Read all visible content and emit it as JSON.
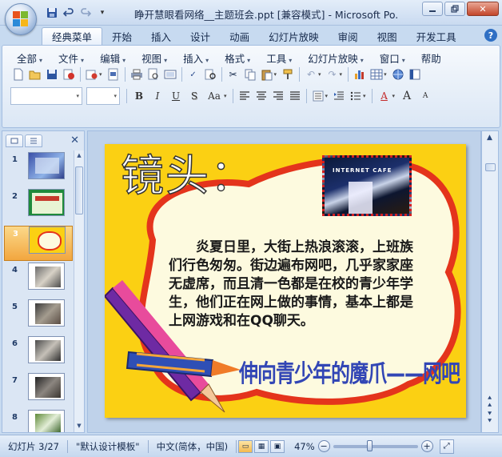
{
  "window": {
    "title": "睁开慧眼看网络__主题班会.ppt [兼容模式] - Microsoft Po...",
    "minimize_icon": "minimize-icon",
    "maximize_icon": "restore-icon",
    "close_icon": "close-icon"
  },
  "quick_access": [
    "save-icon",
    "undo-icon",
    "redo-icon",
    "customize-icon"
  ],
  "tabs": [
    "经典菜单",
    "开始",
    "插入",
    "设计",
    "动画",
    "幻灯片放映",
    "审阅",
    "视图",
    "开发工具"
  ],
  "active_tab": "经典菜单",
  "help_label": "?",
  "menus": [
    "全部",
    "文件",
    "编辑",
    "视图",
    "插入",
    "格式",
    "工具",
    "幻灯片放映",
    "窗口",
    "帮助"
  ],
  "toolbar_icons_row1": [
    "new-icon",
    "open-icon",
    "save-icon",
    "permission-icon",
    "email-icon",
    "pdf-icon",
    "print-icon",
    "print-preview-icon",
    "spelling-icon",
    "research-icon",
    "cut-icon",
    "copy-icon",
    "paste-icon",
    "format-painter-icon",
    "undo-icon",
    "redo-icon",
    "chart-icon",
    "table-icon",
    "hyperlink-icon",
    "slide-icon"
  ],
  "toolbar_icons_row2": [
    "bold-icon",
    "italic-icon",
    "underline-icon",
    "shadow-icon",
    "change-case-icon",
    "align-left-icon",
    "align-center-icon",
    "align-right-icon",
    "justify-icon",
    "numbering-icon",
    "decrease-indent-icon",
    "bullets-icon",
    "font-color-icon",
    "grow-font-icon",
    "shrink-font-icon"
  ],
  "font_format": {
    "bold": "B",
    "italic": "I",
    "underline": "U",
    "shadow": "S",
    "case": "Aa",
    "grow": "A",
    "shrink": "A"
  },
  "slides": [
    {
      "number": "1",
      "style": "blue"
    },
    {
      "number": "2",
      "style": "green"
    },
    {
      "number": "3",
      "style": "yellow"
    },
    {
      "number": "4",
      "style": "photo"
    },
    {
      "number": "5",
      "style": "photo"
    },
    {
      "number": "6",
      "style": "photo"
    },
    {
      "number": "7",
      "style": "photo"
    },
    {
      "number": "8",
      "style": "photo"
    }
  ],
  "selected_slide": "3",
  "slide_content": {
    "heading": "镜头：",
    "photo_caption": "INTERNET CAFE",
    "body": "炎夏日里，大街上热浪滚滚，上班族们行色匆匆。街边遍布网吧，几乎家家座无虚席，而且清一色都是在校的青少年学生，他们正在网上做的事情，基本上都是上网游戏和在QQ聊天。",
    "caption": "伸向青少年的魔爪——网吧"
  },
  "status": {
    "slide_counter": "幻灯片 3/27",
    "template": "\"默认设计模板\"",
    "language": "中文(简体，中国)",
    "zoom": "47%",
    "zoom_level": 0.47
  },
  "colors": {
    "slide_background": "#fbd013",
    "bubble_border": "#e4341c",
    "bubble_fill": "#fdfadf",
    "caption_blue": "#3246b5",
    "ribbon_bg": "#dbe7f5"
  }
}
